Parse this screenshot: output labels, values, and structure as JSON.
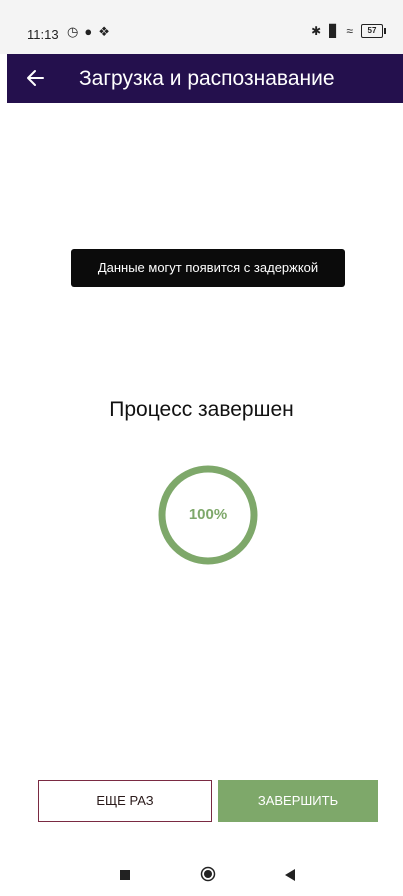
{
  "status_bar": {
    "time": "11:13",
    "battery": "57",
    "left_icons": [
      "alarm-icon",
      "notification-icon",
      "data-saver-icon"
    ],
    "right_icons": [
      "bluetooth-icon",
      "signal-icon",
      "wifi-icon",
      "battery-icon"
    ]
  },
  "app_bar": {
    "title": "Загрузка и распознавание",
    "background_color": "#24104d",
    "back_icon": "arrow-left-icon"
  },
  "toast": {
    "message": "Данные могут появится с задержкой"
  },
  "main": {
    "heading": "Процесс завершен",
    "progress": {
      "label": "100%",
      "value": 1.0,
      "color": "#7ea86a"
    }
  },
  "actions": {
    "again_label": "ЕЩЕ РАЗ",
    "finish_label": "ЗАВЕРШИТЬ",
    "again_border_color": "#7a2a42",
    "finish_color": "#7ea86a"
  },
  "nav_bar": {
    "icons": [
      "recent-apps-icon",
      "home-icon",
      "back-icon"
    ]
  }
}
